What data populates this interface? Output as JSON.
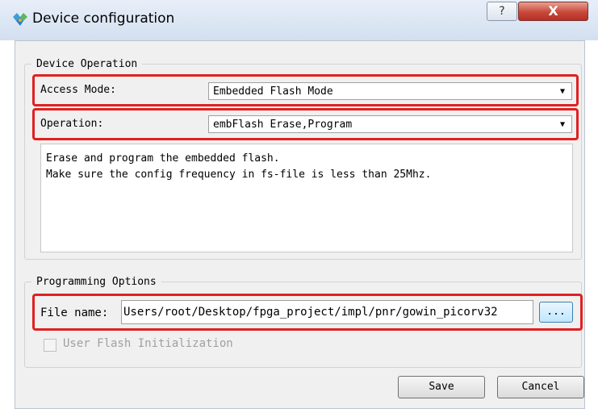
{
  "window": {
    "title": "Device configuration",
    "help_glyph": "?",
    "close_glyph": "X"
  },
  "device_operation": {
    "legend": "Device Operation",
    "access_mode_label": "Access Mode:",
    "access_mode_value": "Embedded Flash Mode",
    "operation_label": "Operation:",
    "operation_value": "embFlash Erase,Program",
    "description": "Erase and program the embedded flash.\nMake sure the config frequency in fs-file is less than 25Mhz."
  },
  "programming_options": {
    "legend": "Programming Options",
    "file_name_label": "File name:",
    "file_name_value": "Users/root/Desktop/fpga_project/impl/pnr/gowin_picorv32",
    "browse_label": "...",
    "user_flash_label": "User Flash Initialization",
    "user_flash_checked": false
  },
  "buttons": {
    "save": "Save",
    "cancel": "Cancel"
  },
  "dropdown_arrow": "▼",
  "colors": {
    "highlight": "#e02020",
    "titlebar": "#dbe6f4",
    "close": "#c8483a"
  }
}
